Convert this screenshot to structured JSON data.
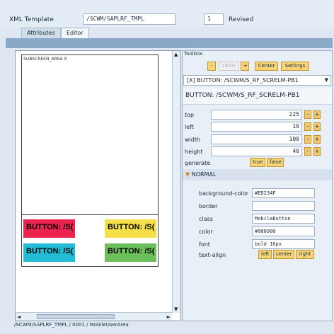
{
  "header": {
    "template_label": "XML Template",
    "template_value": "/SCWM/SAPLRF_TMPL",
    "version_value": "1",
    "status_text": "Revised"
  },
  "tabs": [
    {
      "label": "Attributes",
      "active": false
    },
    {
      "label": "Editor",
      "active": true
    }
  ],
  "canvas": {
    "subscreen_label": "SUBSCREEN_AREA  X",
    "buttons": [
      {
        "label": "BUTTON: /S(",
        "color": "#ED234F"
      },
      {
        "label": "BUTTON: /S(",
        "color": "#F5E04A"
      },
      {
        "label": "BUTTON: /S(",
        "color": "#22BCD6"
      },
      {
        "label": "BUTTON: /S(",
        "color": "#6CC05C"
      }
    ],
    "path": "/SCWM/SAPLRF_TMPL / 0001 / MobileUserArea"
  },
  "toolbox": {
    "title": "Toolbox",
    "zoom_minus": "-",
    "zoom_value": "100%",
    "zoom_plus": "+",
    "center_label": "Center",
    "settings_label": "Settings",
    "selected_element": "[X] BUTTON: /SCWM/S_RF_SCRELM-PB1",
    "element_header": "BUTTON: /SCWM/S_RF_SCRELM-PB1",
    "properties": [
      {
        "label": "top",
        "value": "225"
      },
      {
        "label": "left",
        "value": "10"
      },
      {
        "label": "width",
        "value": "100"
      },
      {
        "label": "height",
        "value": "40"
      }
    ],
    "generate_label": "generate",
    "true_label": "true",
    "false_label": "false",
    "section_label": "NORMAL",
    "styles": [
      {
        "label": "background-color",
        "value": "#ED234F"
      },
      {
        "label": "border",
        "value": ""
      },
      {
        "label": "class",
        "value": "MobileButton"
      },
      {
        "label": "color",
        "value": "#000000"
      },
      {
        "label": "font",
        "value": "bold 16px"
      }
    ],
    "text_align_label": "text-align",
    "align_options": [
      "left",
      "center",
      "right"
    ]
  }
}
